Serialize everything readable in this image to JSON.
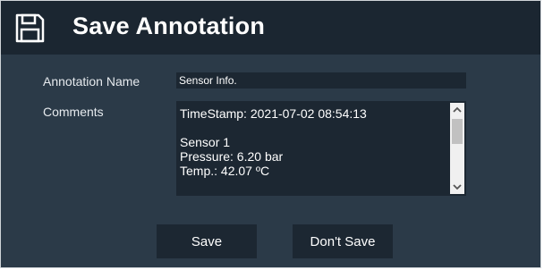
{
  "dialog": {
    "title": "Save Annotation",
    "title_icon": "floppy-disk-icon"
  },
  "form": {
    "name_label": "Annotation Name",
    "name_value": "Sensor Info.",
    "comments_label": "Comments",
    "comments_value": "TimeStamp: 2021-07-02 08:54:13\n\nSensor 1\nPressure: 6.20 bar\nTemp.: 42.07 ºC"
  },
  "buttons": {
    "save_label": "Save",
    "dont_save_label": "Don't Save"
  },
  "colors": {
    "panel_background": "#2b3a48",
    "title_bar_background": "#1b2631",
    "field_background": "#1c2732",
    "text": "#ffffff"
  }
}
